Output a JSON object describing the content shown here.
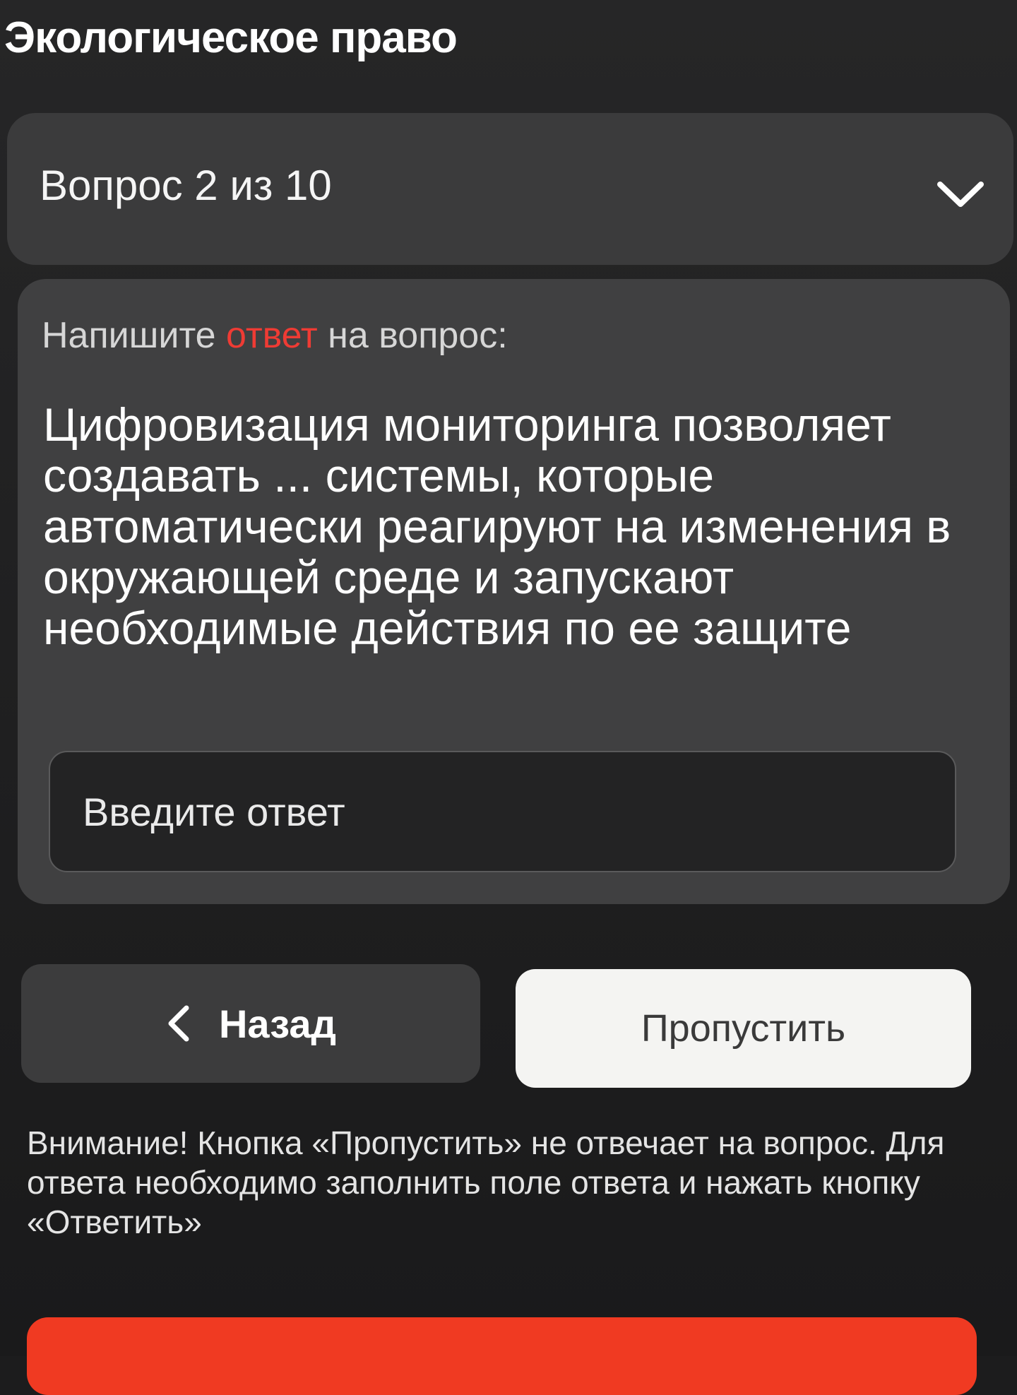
{
  "header": {
    "title": "Экологическое право"
  },
  "question_selector": {
    "counter": "Вопрос 2 из 10",
    "icon": "chevron-down-icon"
  },
  "question_card": {
    "instruction_prefix": "Напишите ",
    "instruction_accent": "ответ",
    "instruction_suffix": " на вопрос:",
    "question_text": "Цифровизация мониторинга позволяет создавать ... системы, которые автоматически реагируют на изменения в окружающей среде и запускают необходимые действия по ее защите",
    "answer_placeholder": "Введите ответ",
    "answer_value": ""
  },
  "actions": {
    "back_label": "Назад",
    "back_icon": "chevron-left-icon",
    "skip_label": "Пропустить"
  },
  "warning": "Внимание! Кнопка «Пропустить» не отвечает на вопрос. Для ответа необходимо заполнить поле ответа и нажать кнопку «Ответить»",
  "colors": {
    "accent": "#ef3b34",
    "background": "#1f1f20",
    "card": "#404041",
    "skip_button": "#f4f4f2"
  }
}
